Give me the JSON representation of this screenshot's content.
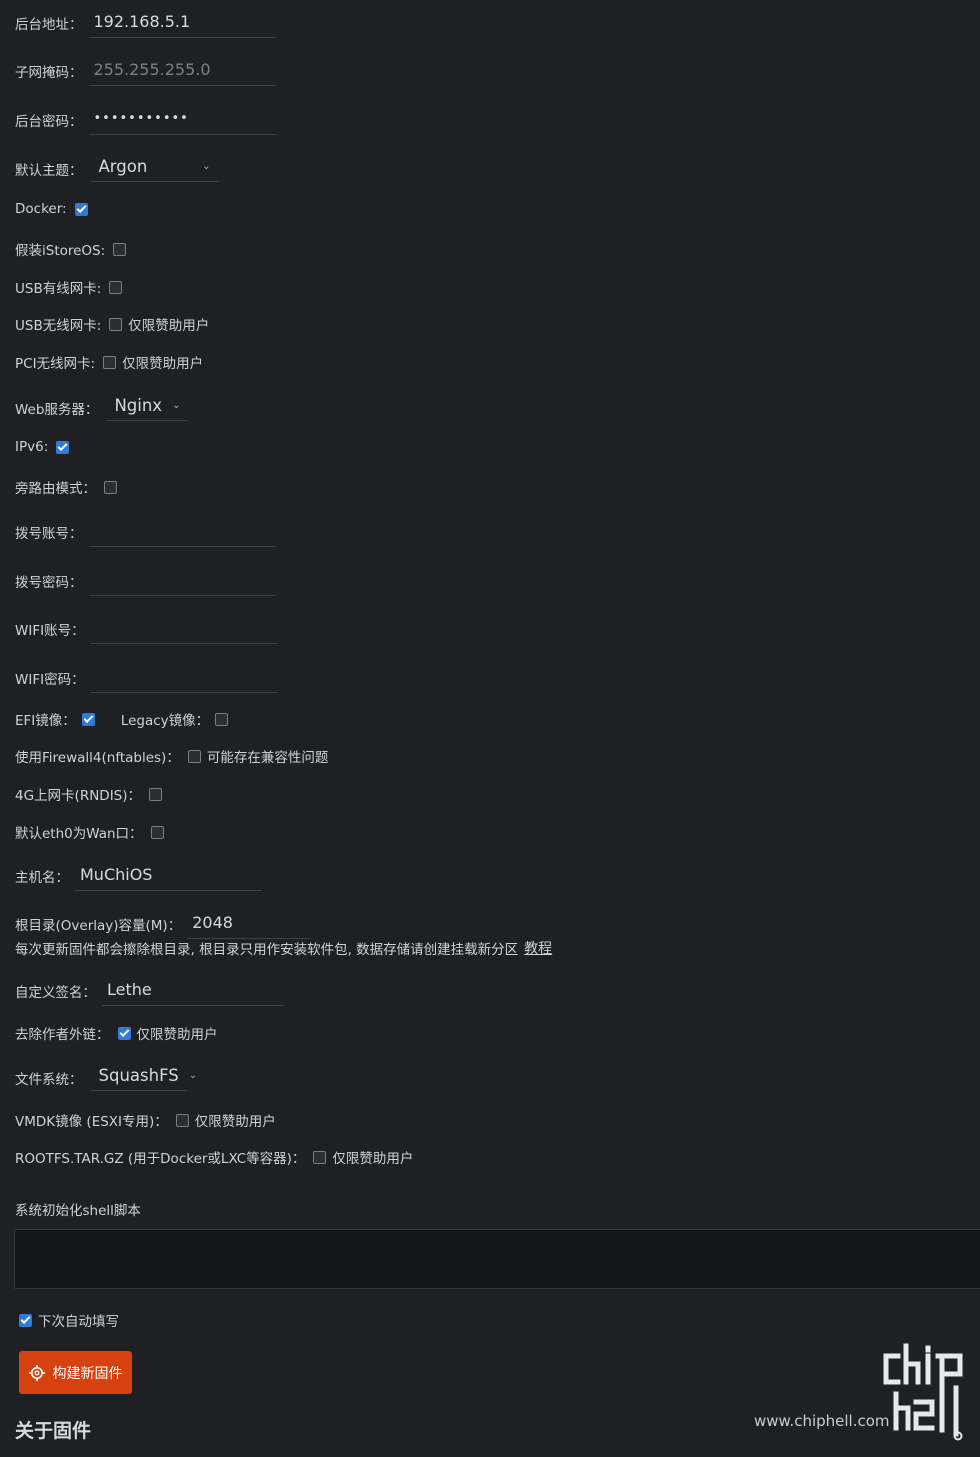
{
  "fields": {
    "backend_address": {
      "label": "后台地址：",
      "value": "192.168.5.1"
    },
    "subnet_mask": {
      "label": "子网掩码：",
      "placeholder": "255.255.255.0"
    },
    "backend_password": {
      "label": "后台密码：",
      "value": "•••••••••••"
    },
    "default_theme": {
      "label": "默认主题：",
      "value": "Argon"
    },
    "docker": {
      "label": "Docker:",
      "checked": true
    },
    "fake_istoreos": {
      "label": "假装iStoreOS:",
      "checked": false
    },
    "usb_wired": {
      "label": "USB有线网卡:",
      "checked": false
    },
    "usb_wireless": {
      "label": "USB无线网卡:",
      "checked": false,
      "note": "仅限赞助用户"
    },
    "pci_wireless": {
      "label": "PCI无线网卡:",
      "checked": false,
      "note": "仅限赞助用户"
    },
    "web_server": {
      "label": "Web服务器：",
      "value": "Nginx"
    },
    "ipv6": {
      "label": "IPv6:",
      "checked": true
    },
    "bypass_mode": {
      "label": "旁路由模式：",
      "checked": false
    },
    "dial_account": {
      "label": "拨号账号：",
      "value": ""
    },
    "dial_password": {
      "label": "拨号密码：",
      "value": ""
    },
    "wifi_account": {
      "label": "WIFI账号：",
      "value": ""
    },
    "wifi_password": {
      "label": "WIFI密码：",
      "value": ""
    },
    "efi_image": {
      "label": "EFI镜像：",
      "checked": true
    },
    "legacy_image": {
      "label": "Legacy镜像：",
      "checked": false
    },
    "firewall4": {
      "label": "使用Firewall4(nftables)：",
      "checked": false,
      "note": "可能存在兼容性问题"
    },
    "lte_rndis": {
      "label": "4G上网卡(RNDIS)：",
      "checked": false
    },
    "eth0_wan": {
      "label": "默认eth0为Wan口：",
      "checked": false
    },
    "hostname": {
      "label": "主机名：",
      "value": "MuChiOS"
    },
    "overlay_size": {
      "label": "根目录(Overlay)容量(M)：",
      "value": "2048"
    },
    "overlay_hint": "每次更新固件都会擦除根目录, 根目录只用作安装软件包, 数据存储请创建挂载新分区",
    "overlay_link": "教程",
    "custom_signature": {
      "label": "自定义签名：",
      "value": "Lethe"
    },
    "remove_author_link": {
      "label": "去除作者外链：",
      "checked": true,
      "note": "仅限赞助用户"
    },
    "filesystem": {
      "label": "文件系统：",
      "value": "SquashFS"
    },
    "vmdk_image": {
      "label": "VMDK镜像 (ESXI专用)：",
      "checked": false,
      "note": "仅限赞助用户"
    },
    "rootfs_tar": {
      "label": "ROOTFS.TAR.GZ (用于Docker或LXC等容器)：",
      "checked": false,
      "note": "仅限赞助用户"
    },
    "init_script": {
      "label": "系统初始化shell脚本",
      "value": ""
    },
    "auto_fill": {
      "label": "下次自动填写",
      "checked": true
    }
  },
  "build_button": {
    "label": "构建新固件",
    "color": "#d5420f"
  },
  "section_title": "关于固件",
  "watermark": {
    "site": "www.chiphell.com",
    "logo": "chip hell"
  },
  "colors": {
    "background": "#1e2024",
    "checkbox_on": "#2f7bd6"
  }
}
